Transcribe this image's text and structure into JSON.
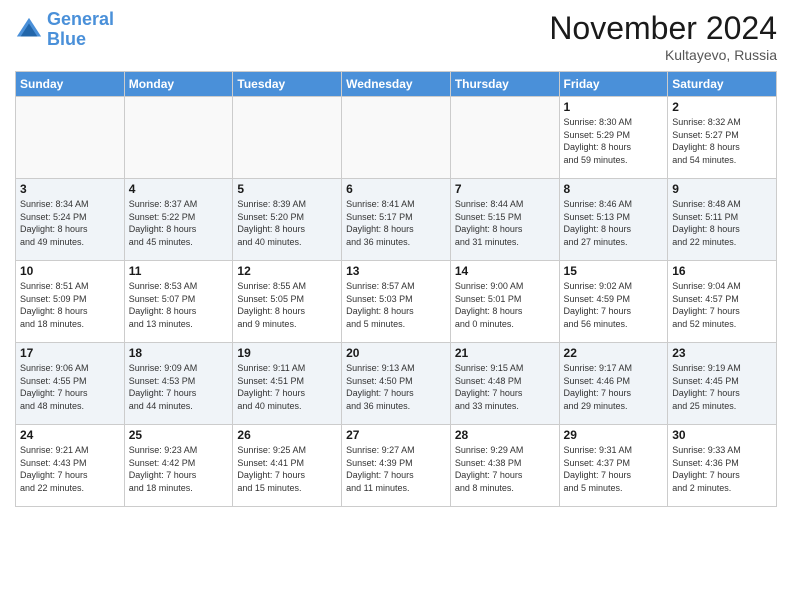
{
  "header": {
    "logo_line1": "General",
    "logo_line2": "Blue",
    "month": "November 2024",
    "location": "Kultayevo, Russia"
  },
  "weekdays": [
    "Sunday",
    "Monday",
    "Tuesday",
    "Wednesday",
    "Thursday",
    "Friday",
    "Saturday"
  ],
  "weeks": [
    [
      {
        "day": "",
        "info": ""
      },
      {
        "day": "",
        "info": ""
      },
      {
        "day": "",
        "info": ""
      },
      {
        "day": "",
        "info": ""
      },
      {
        "day": "",
        "info": ""
      },
      {
        "day": "1",
        "info": "Sunrise: 8:30 AM\nSunset: 5:29 PM\nDaylight: 8 hours\nand 59 minutes."
      },
      {
        "day": "2",
        "info": "Sunrise: 8:32 AM\nSunset: 5:27 PM\nDaylight: 8 hours\nand 54 minutes."
      }
    ],
    [
      {
        "day": "3",
        "info": "Sunrise: 8:34 AM\nSunset: 5:24 PM\nDaylight: 8 hours\nand 49 minutes."
      },
      {
        "day": "4",
        "info": "Sunrise: 8:37 AM\nSunset: 5:22 PM\nDaylight: 8 hours\nand 45 minutes."
      },
      {
        "day": "5",
        "info": "Sunrise: 8:39 AM\nSunset: 5:20 PM\nDaylight: 8 hours\nand 40 minutes."
      },
      {
        "day": "6",
        "info": "Sunrise: 8:41 AM\nSunset: 5:17 PM\nDaylight: 8 hours\nand 36 minutes."
      },
      {
        "day": "7",
        "info": "Sunrise: 8:44 AM\nSunset: 5:15 PM\nDaylight: 8 hours\nand 31 minutes."
      },
      {
        "day": "8",
        "info": "Sunrise: 8:46 AM\nSunset: 5:13 PM\nDaylight: 8 hours\nand 27 minutes."
      },
      {
        "day": "9",
        "info": "Sunrise: 8:48 AM\nSunset: 5:11 PM\nDaylight: 8 hours\nand 22 minutes."
      }
    ],
    [
      {
        "day": "10",
        "info": "Sunrise: 8:51 AM\nSunset: 5:09 PM\nDaylight: 8 hours\nand 18 minutes."
      },
      {
        "day": "11",
        "info": "Sunrise: 8:53 AM\nSunset: 5:07 PM\nDaylight: 8 hours\nand 13 minutes."
      },
      {
        "day": "12",
        "info": "Sunrise: 8:55 AM\nSunset: 5:05 PM\nDaylight: 8 hours\nand 9 minutes."
      },
      {
        "day": "13",
        "info": "Sunrise: 8:57 AM\nSunset: 5:03 PM\nDaylight: 8 hours\nand 5 minutes."
      },
      {
        "day": "14",
        "info": "Sunrise: 9:00 AM\nSunset: 5:01 PM\nDaylight: 8 hours\nand 0 minutes."
      },
      {
        "day": "15",
        "info": "Sunrise: 9:02 AM\nSunset: 4:59 PM\nDaylight: 7 hours\nand 56 minutes."
      },
      {
        "day": "16",
        "info": "Sunrise: 9:04 AM\nSunset: 4:57 PM\nDaylight: 7 hours\nand 52 minutes."
      }
    ],
    [
      {
        "day": "17",
        "info": "Sunrise: 9:06 AM\nSunset: 4:55 PM\nDaylight: 7 hours\nand 48 minutes."
      },
      {
        "day": "18",
        "info": "Sunrise: 9:09 AM\nSunset: 4:53 PM\nDaylight: 7 hours\nand 44 minutes."
      },
      {
        "day": "19",
        "info": "Sunrise: 9:11 AM\nSunset: 4:51 PM\nDaylight: 7 hours\nand 40 minutes."
      },
      {
        "day": "20",
        "info": "Sunrise: 9:13 AM\nSunset: 4:50 PM\nDaylight: 7 hours\nand 36 minutes."
      },
      {
        "day": "21",
        "info": "Sunrise: 9:15 AM\nSunset: 4:48 PM\nDaylight: 7 hours\nand 33 minutes."
      },
      {
        "day": "22",
        "info": "Sunrise: 9:17 AM\nSunset: 4:46 PM\nDaylight: 7 hours\nand 29 minutes."
      },
      {
        "day": "23",
        "info": "Sunrise: 9:19 AM\nSunset: 4:45 PM\nDaylight: 7 hours\nand 25 minutes."
      }
    ],
    [
      {
        "day": "24",
        "info": "Sunrise: 9:21 AM\nSunset: 4:43 PM\nDaylight: 7 hours\nand 22 minutes."
      },
      {
        "day": "25",
        "info": "Sunrise: 9:23 AM\nSunset: 4:42 PM\nDaylight: 7 hours\nand 18 minutes."
      },
      {
        "day": "26",
        "info": "Sunrise: 9:25 AM\nSunset: 4:41 PM\nDaylight: 7 hours\nand 15 minutes."
      },
      {
        "day": "27",
        "info": "Sunrise: 9:27 AM\nSunset: 4:39 PM\nDaylight: 7 hours\nand 11 minutes."
      },
      {
        "day": "28",
        "info": "Sunrise: 9:29 AM\nSunset: 4:38 PM\nDaylight: 7 hours\nand 8 minutes."
      },
      {
        "day": "29",
        "info": "Sunrise: 9:31 AM\nSunset: 4:37 PM\nDaylight: 7 hours\nand 5 minutes."
      },
      {
        "day": "30",
        "info": "Sunrise: 9:33 AM\nSunset: 4:36 PM\nDaylight: 7 hours\nand 2 minutes."
      }
    ]
  ]
}
